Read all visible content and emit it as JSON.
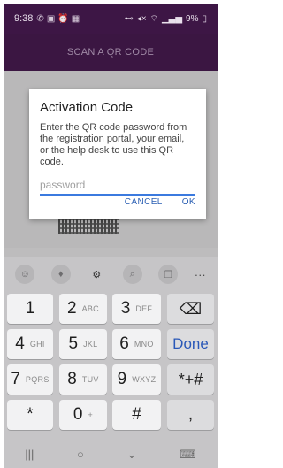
{
  "status_bar": {
    "time": "9:38",
    "left_icons": [
      "whatsapp-icon",
      "gallery-icon",
      "alarm-icon",
      "chat-icon"
    ],
    "right_text": "9%"
  },
  "app_bar": {
    "title": "SCAN A QR CODE"
  },
  "dialog": {
    "title": "Activation Code",
    "message": "Enter the QR code password from the registration portal, your email, or the help desk to use this QR code.",
    "input_placeholder": "password",
    "input_value": "",
    "cancel_label": "CANCEL",
    "ok_label": "OK"
  },
  "keyboard": {
    "suggestions": [
      "emoji-icon",
      "mic-icon",
      "settings-icon",
      "search-icon",
      "clipboard-icon"
    ],
    "more_label": "···",
    "rows": [
      [
        {
          "main": "1",
          "sub": ""
        },
        {
          "main": "2",
          "sub": "ABC"
        },
        {
          "main": "3",
          "sub": "DEF"
        },
        {
          "main": "⌫",
          "sub": ""
        }
      ],
      [
        {
          "main": "4",
          "sub": "GHI"
        },
        {
          "main": "5",
          "sub": "JKL"
        },
        {
          "main": "6",
          "sub": "MNO"
        },
        {
          "main": "Done",
          "sub": ""
        }
      ],
      [
        {
          "main": "7",
          "sub": "PQRS"
        },
        {
          "main": "8",
          "sub": "TUV"
        },
        {
          "main": "9",
          "sub": "WXYZ"
        },
        {
          "main": "*+#",
          "sub": ""
        }
      ],
      [
        {
          "main": "*",
          "sub": ""
        },
        {
          "main": "0",
          "sub": "+"
        },
        {
          "main": "#",
          "sub": ""
        },
        {
          "main": ",",
          "sub": ""
        }
      ]
    ]
  },
  "nav_bar": {
    "recents": "|||",
    "home": "○",
    "back": "⌄",
    "keyboard": "⌨"
  },
  "colors": {
    "accent": "#3b7adf",
    "app_bar": "#3b1642",
    "button_text": "#2b5fb3"
  }
}
